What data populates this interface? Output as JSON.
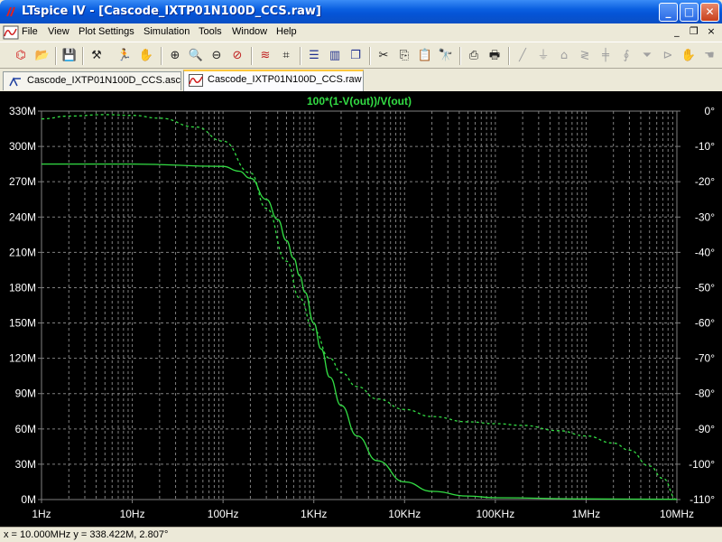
{
  "window": {
    "title": "LTspice IV - [Cascode_IXTP01N100D_CCS.raw]",
    "controls": {
      "minimize": "_",
      "maximize": "□",
      "close": "✕"
    }
  },
  "menu": {
    "items": [
      "File",
      "View",
      "Plot Settings",
      "Simulation",
      "Tools",
      "Window",
      "Help"
    ],
    "mdi": {
      "minimize": "_",
      "restore": "❐",
      "close": "×"
    }
  },
  "toolbar": {
    "icons": [
      "new-schematic-icon",
      "open-icon",
      "save-icon",
      "control-panel-icon",
      "run-icon",
      "halt-icon",
      "zoom-in-icon",
      "zoom-box-icon",
      "zoom-out-icon",
      "zoom-cancel-icon",
      "autorange-icon",
      "pick-visible-traces-icon",
      "tile-horizontal-icon",
      "tile-vertical-icon",
      "cascade-icon",
      "cut-icon",
      "copy-icon",
      "paste-icon",
      "find-icon",
      "print-preview-icon",
      "print-icon",
      "wire-icon",
      "ground-icon",
      "label-icon",
      "resistor-icon",
      "capacitor-icon",
      "inductor-icon",
      "diode-icon",
      "component-icon",
      "move-icon",
      "drag-icon"
    ]
  },
  "tabs": [
    {
      "label": "Cascode_IXTP01N100D_CCS.asc",
      "active": false,
      "icon": "schematic-icon"
    },
    {
      "label": "Cascode_IXTP01N100D_CCS.raw",
      "active": true,
      "icon": "waveform-icon"
    }
  ],
  "status": {
    "text": "x = 10.000MHz    y = 338.422M, 2.807°"
  },
  "colors": {
    "trace": "#33dd44",
    "grid": "#808080",
    "axis_text": "#ffffff",
    "background": "#000000"
  },
  "chart_data": {
    "type": "line",
    "title": "100*(1-V(out))/V(out)",
    "xscale": "log",
    "xlim": [
      1,
      10000000
    ],
    "x_ticks": [
      {
        "value": 1,
        "label": "1Hz"
      },
      {
        "value": 10,
        "label": "10Hz"
      },
      {
        "value": 100,
        "label": "100Hz"
      },
      {
        "value": 1000,
        "label": "1KHz"
      },
      {
        "value": 10000,
        "label": "10KHz"
      },
      {
        "value": 100000,
        "label": "100KHz"
      },
      {
        "value": 1000000,
        "label": "1MHz"
      },
      {
        "value": 10000000,
        "label": "10MHz"
      }
    ],
    "ylim": [
      0,
      330000000
    ],
    "y_ticks": [
      {
        "value": 0,
        "label": "0M"
      },
      {
        "value": 30000000,
        "label": "30M"
      },
      {
        "value": 60000000,
        "label": "60M"
      },
      {
        "value": 90000000,
        "label": "90M"
      },
      {
        "value": 120000000,
        "label": "120M"
      },
      {
        "value": 150000000,
        "label": "150M"
      },
      {
        "value": 180000000,
        "label": "180M"
      },
      {
        "value": 210000000,
        "label": "210M"
      },
      {
        "value": 240000000,
        "label": "240M"
      },
      {
        "value": 270000000,
        "label": "270M"
      },
      {
        "value": 300000000,
        "label": "300M"
      },
      {
        "value": 330000000,
        "label": "330M"
      }
    ],
    "y2lim": [
      -110,
      0
    ],
    "y2_ticks": [
      {
        "value": 0,
        "label": "0°"
      },
      {
        "value": -10,
        "label": "-10°"
      },
      {
        "value": -20,
        "label": "-20°"
      },
      {
        "value": -30,
        "label": "-30°"
      },
      {
        "value": -40,
        "label": "-40°"
      },
      {
        "value": -50,
        "label": "-50°"
      },
      {
        "value": -60,
        "label": "-60°"
      },
      {
        "value": -70,
        "label": "-70°"
      },
      {
        "value": -80,
        "label": "-80°"
      },
      {
        "value": -90,
        "label": "-90°"
      },
      {
        "value": -100,
        "label": "-100°"
      },
      {
        "value": -110,
        "label": "-110°"
      }
    ],
    "grid": true,
    "series": [
      {
        "axis": "left",
        "style": "solid",
        "x": [
          1,
          10,
          100,
          150,
          200,
          300,
          400,
          500,
          600,
          700,
          800,
          1000,
          1200,
          1500,
          2000,
          3000,
          5000,
          10000,
          20000,
          50000,
          100000,
          1000000,
          10000000
        ],
        "y": [
          285000000,
          285000000,
          283000000,
          279000000,
          273000000,
          255000000,
          238000000,
          220000000,
          205000000,
          190000000,
          176000000,
          150000000,
          128000000,
          104000000,
          80000000,
          54000000,
          33000000,
          15000000,
          7000000,
          3000000,
          1500000,
          500000,
          200000
        ]
      },
      {
        "axis": "right",
        "style": "dashed",
        "x": [
          1,
          2,
          5,
          10,
          20,
          50,
          100,
          200,
          300,
          500,
          700,
          1000,
          1500,
          2000,
          3000,
          5000,
          10000,
          20000,
          50000,
          100000,
          200000,
          500000,
          1000000,
          2000000,
          3000000,
          5000000,
          7000000,
          10000000
        ],
        "y": [
          -2.2,
          -1.4,
          -1.0,
          -1.2,
          -2.0,
          -4.5,
          -8.5,
          -17.5,
          -27.5,
          -42.5,
          -53,
          -62,
          -70,
          -74,
          -78,
          -81.5,
          -84.5,
          -86.5,
          -88,
          -88.5,
          -89,
          -90.5,
          -92,
          -94,
          -96,
          -100.5,
          -104,
          -110
        ]
      }
    ]
  }
}
